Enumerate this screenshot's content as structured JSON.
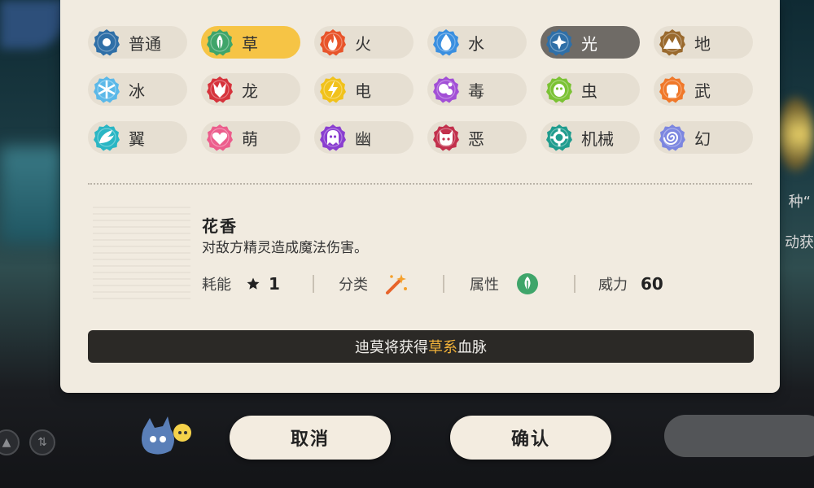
{
  "types": [
    {
      "label": "普通",
      "icon": "normal-icon",
      "color": "#2f6fa7",
      "state": "normal"
    },
    {
      "label": "草",
      "icon": "grass-icon",
      "color": "#3fa56a",
      "state": "selected-orange"
    },
    {
      "label": "火",
      "icon": "fire-icon",
      "color": "#e8542a",
      "state": "normal"
    },
    {
      "label": "水",
      "icon": "water-icon",
      "color": "#3a8fe0",
      "state": "normal"
    },
    {
      "label": "光",
      "icon": "light-icon",
      "color": "#2f6fa7",
      "state": "selected-dark"
    },
    {
      "label": "地",
      "icon": "ground-icon",
      "color": "#9a6a2e",
      "state": "normal"
    },
    {
      "label": "冰",
      "icon": "ice-icon",
      "color": "#5bb8e8",
      "state": "normal"
    },
    {
      "label": "龙",
      "icon": "dragon-icon",
      "color": "#d6333c",
      "state": "normal"
    },
    {
      "label": "电",
      "icon": "electric-icon",
      "color": "#f1c21b",
      "state": "normal"
    },
    {
      "label": "毒",
      "icon": "poison-icon",
      "color": "#a24fd6",
      "state": "normal"
    },
    {
      "label": "虫",
      "icon": "bug-icon",
      "color": "#7bc234",
      "state": "normal"
    },
    {
      "label": "武",
      "icon": "fighting-icon",
      "color": "#f0782a",
      "state": "normal"
    },
    {
      "label": "翼",
      "icon": "wing-icon",
      "color": "#2ab6c4",
      "state": "normal"
    },
    {
      "label": "萌",
      "icon": "cute-icon",
      "color": "#ec5d8c",
      "state": "normal"
    },
    {
      "label": "幽",
      "icon": "ghost-icon",
      "color": "#8a3ed0",
      "state": "normal"
    },
    {
      "label": "恶",
      "icon": "evil-icon",
      "color": "#c2304c",
      "state": "normal"
    },
    {
      "label": "机械",
      "icon": "mechanical-icon",
      "color": "#1f9c8e",
      "state": "normal"
    },
    {
      "label": "幻",
      "icon": "illusion-icon",
      "color": "#7c86e0",
      "state": "normal"
    }
  ],
  "skill": {
    "name": "花香",
    "description": "对敌方精灵造成魔法伤害。",
    "cost_label": "耗能",
    "cost_value": "1",
    "category_label": "分类",
    "category_icon": "magic-wand-icon",
    "attribute_label": "属性",
    "attribute_icon": "grass-icon",
    "power_label": "威力",
    "power_value": "60"
  },
  "banner": {
    "prefix": "迪莫将获得",
    "highlight": "草系",
    "suffix": "血脉",
    "highlight_color": "#f2b23a"
  },
  "buttons": {
    "cancel": "取消",
    "confirm": "确认"
  },
  "background": {
    "right_text_1": "种“",
    "right_text_2": "动获"
  }
}
